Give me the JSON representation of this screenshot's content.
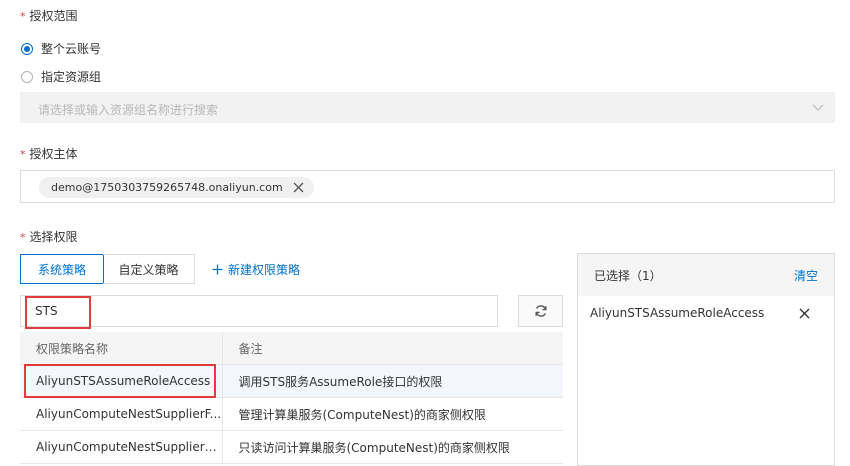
{
  "scope": {
    "label": "授权范围",
    "options": [
      {
        "label": "整个云账号",
        "checked": true
      },
      {
        "label": "指定资源组",
        "checked": false
      }
    ],
    "resource_group_placeholder": "请选择或输入资源组名称进行搜索"
  },
  "principal": {
    "label": "授权主体",
    "tag": "demo@1750303759265748.onaliyun.com"
  },
  "permissions": {
    "label": "选择权限",
    "tabs": [
      {
        "label": "系统策略",
        "active": true
      },
      {
        "label": "自定义策略",
        "active": false
      }
    ],
    "new_policy_link": "新建权限策略",
    "search_value": "STS",
    "table": {
      "columns": [
        "权限策略名称",
        "备注"
      ],
      "rows": [
        {
          "name": "AliyunSTSAssumeRoleAccess",
          "note": "调用STS服务AssumeRole接口的权限"
        },
        {
          "name": "AliyunComputeNestSupplierF...",
          "note": "管理计算巢服务(ComputeNest)的商家侧权限"
        },
        {
          "name": "AliyunComputeNestSupplierR...",
          "note": "只读访问计算巢服务(ComputeNest)的商家侧权限"
        }
      ]
    }
  },
  "selected": {
    "title": "已选择（1）",
    "clear_label": "清空",
    "items": [
      "AliyunSTSAssumeRoleAccess"
    ]
  },
  "colors": {
    "accent": "#0070cc",
    "required": "#e0403a",
    "highlight_box": "#e23b3b"
  },
  "icons": [
    "close-icon",
    "chevron-down-icon",
    "plus-icon",
    "refresh-icon"
  ]
}
